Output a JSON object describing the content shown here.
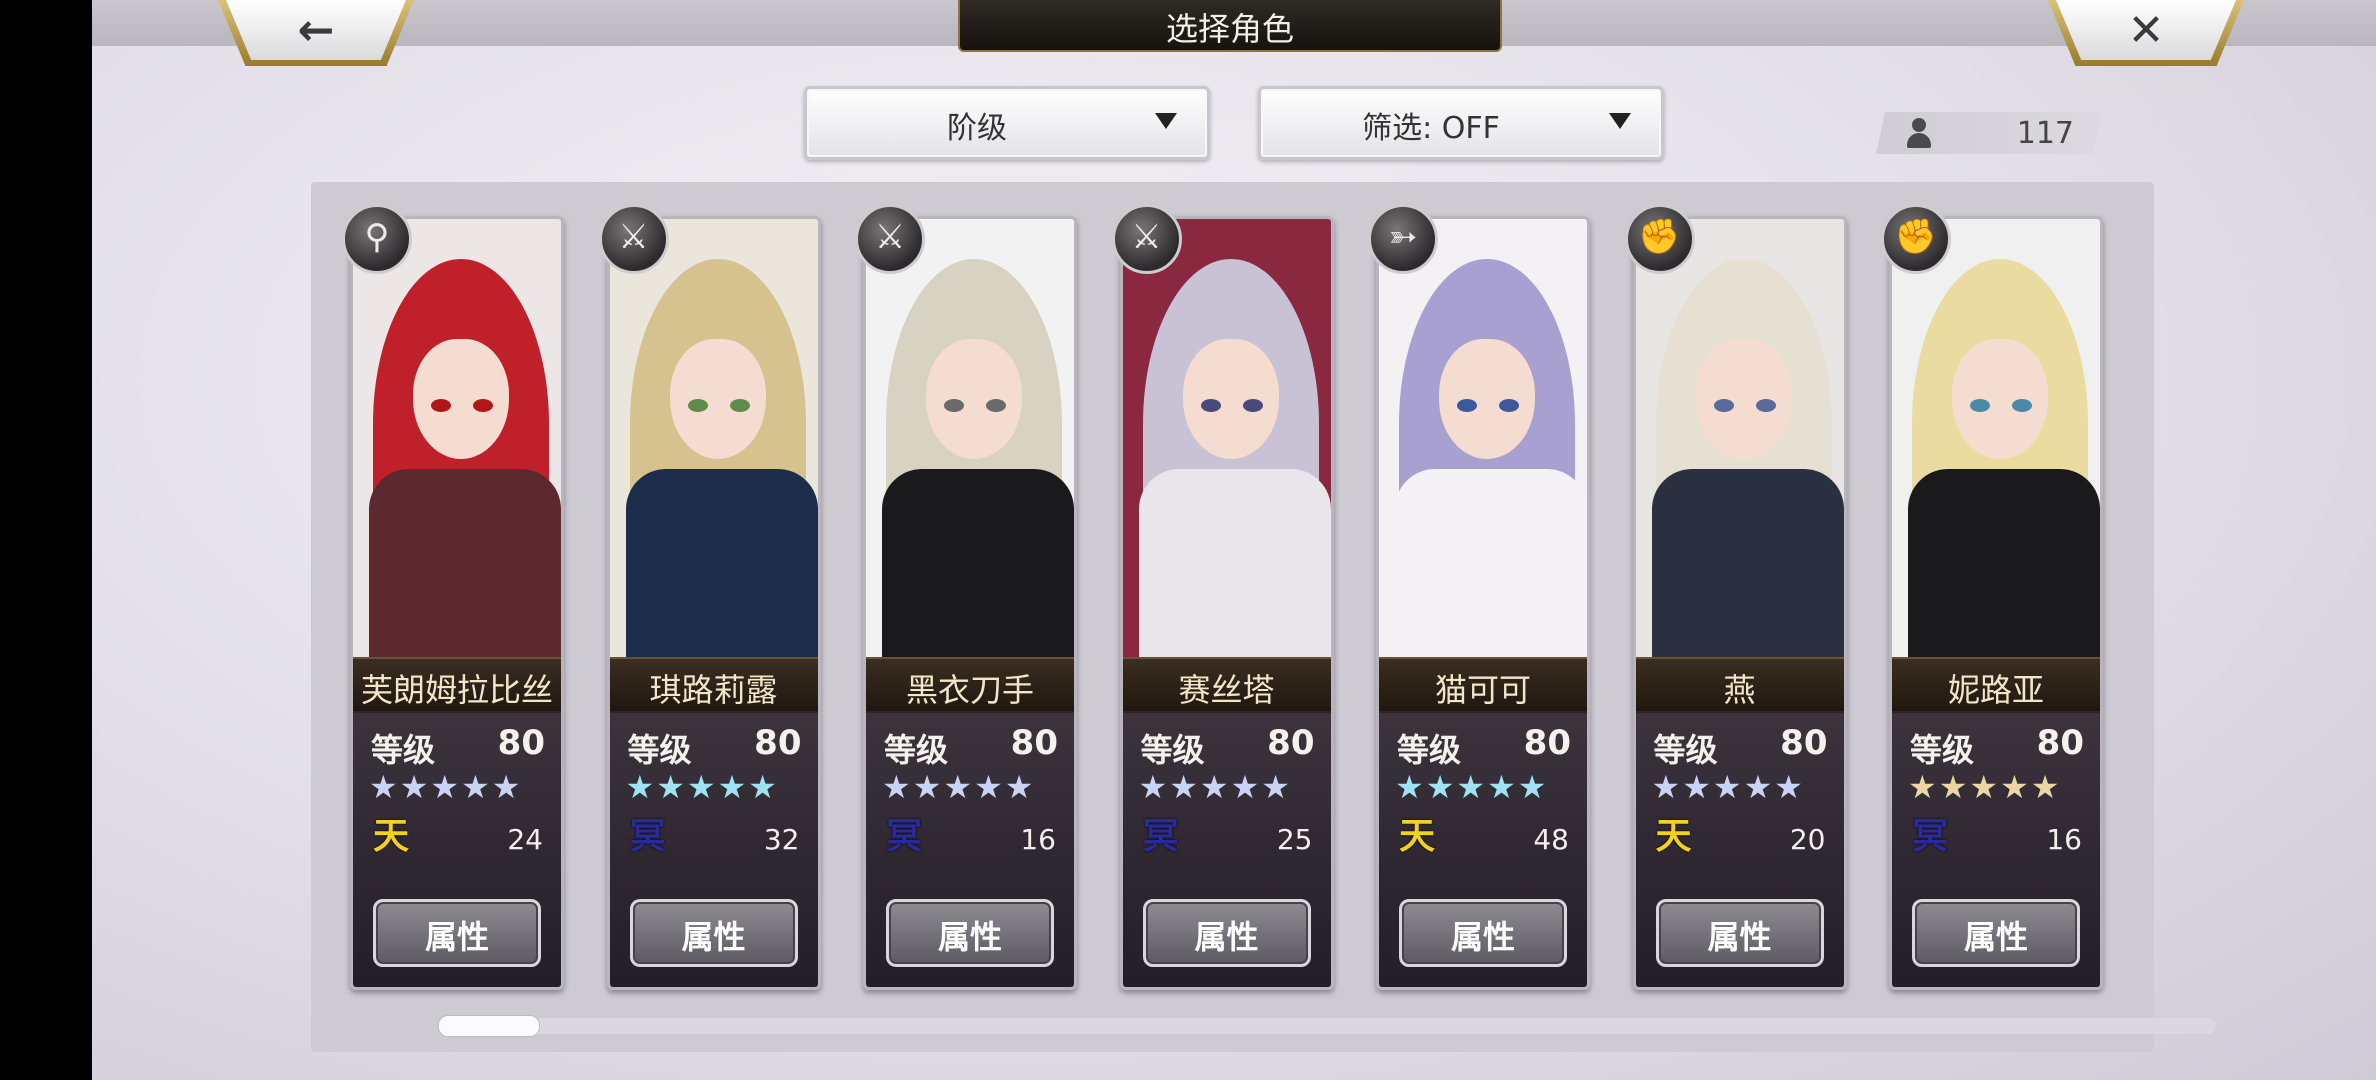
{
  "header": {
    "title": "选择角色",
    "back_icon": "←",
    "close_icon": "✕"
  },
  "filters": {
    "sort_label": "阶级",
    "filter_label": "筛选: OFF"
  },
  "roster": {
    "count": "117"
  },
  "card_common": {
    "level_label": "等级",
    "attribute_button": "属性",
    "stars": "★★★★★"
  },
  "characters": [
    {
      "name": "芙朗姆拉比丝",
      "level": "80",
      "rank": "天",
      "count": "24",
      "weapon": "staff-icon",
      "weapon_glyph": "⚲",
      "colors": {
        "bg": "#ece6e6",
        "hair": "#c0202a",
        "eye": "#b01818",
        "body": "#5c2a2e",
        "star": "#c9d4f2",
        "rank": "#f3d21f"
      }
    },
    {
      "name": "琪路莉露",
      "level": "80",
      "rank": "冥",
      "count": "32",
      "weapon": "sword-icon",
      "weapon_glyph": "⚔",
      "colors": {
        "bg": "#eae6dc",
        "hair": "#d6c28e",
        "eye": "#5f8a4c",
        "body": "#1e2c4c",
        "star": "#9fe2f0",
        "rank": "#2a2a9a"
      }
    },
    {
      "name": "黑衣刀手",
      "level": "80",
      "rank": "冥",
      "count": "16",
      "weapon": "katana-icon",
      "weapon_glyph": "⚔",
      "colors": {
        "bg": "#f2f2f2",
        "hair": "#d8d2c2",
        "eye": "#6a6a6a",
        "body": "#1a1a1c",
        "star": "#c9d4f2",
        "rank": "#2a2a9a"
      }
    },
    {
      "name": "赛丝塔",
      "level": "80",
      "rank": "冥",
      "count": "25",
      "weapon": "katana-icon",
      "weapon_glyph": "⚔",
      "colors": {
        "bg": "#8a2840",
        "hair": "#c8c2d4",
        "eye": "#4a4a7a",
        "body": "#e8e6ea",
        "star": "#c9d4f2",
        "rank": "#2a2a9a"
      }
    },
    {
      "name": "猫可可",
      "level": "80",
      "rank": "天",
      "count": "48",
      "weapon": "bow-icon",
      "weapon_glyph": "➳",
      "colors": {
        "bg": "#f3f1f4",
        "hair": "#a8a0d0",
        "eye": "#3c5a9a",
        "body": "#f4f2f4",
        "star": "#9fe2f0",
        "rank": "#f3d21f"
      }
    },
    {
      "name": "燕",
      "level": "80",
      "rank": "天",
      "count": "20",
      "weapon": "fist-icon",
      "weapon_glyph": "✊",
      "colors": {
        "bg": "#e8e6e4",
        "hair": "#e6e0d2",
        "eye": "#5a6a9a",
        "body": "#2a3040",
        "star": "#c9d4f2",
        "rank": "#f3d21f"
      }
    },
    {
      "name": "妮路亚",
      "level": "80",
      "rank": "冥",
      "count": "16",
      "weapon": "fist-icon",
      "weapon_glyph": "✊",
      "colors": {
        "bg": "#f0f0f0",
        "hair": "#eadca0",
        "eye": "#4a8aa8",
        "body": "#1a1a1c",
        "star": "#ead7a4",
        "rank": "#2a2a9a"
      }
    }
  ]
}
